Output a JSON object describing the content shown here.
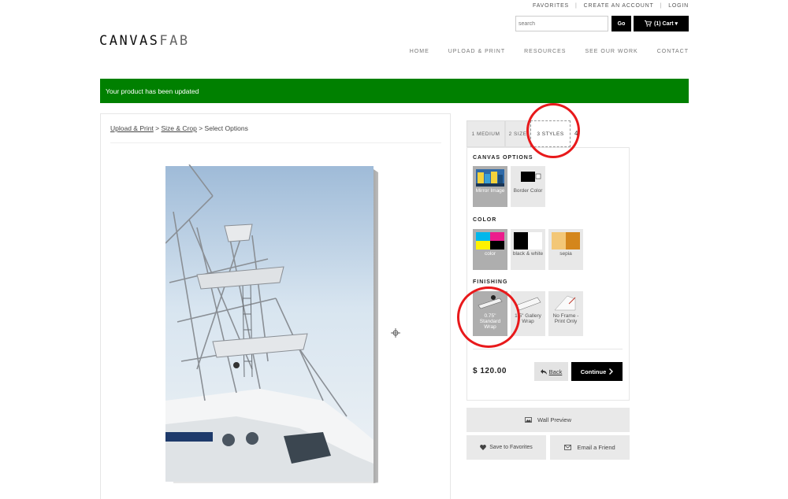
{
  "top_links": [
    "FAVORITES",
    "CREATE AN ACCOUNT",
    "LOGIN"
  ],
  "search": {
    "placeholder": "search",
    "go_label": "Go"
  },
  "cart": {
    "label": "(1)  Cart ▾"
  },
  "logo": {
    "main": "CANVAS",
    "suffix": "FAB"
  },
  "nav": [
    "HOME",
    "UPLOAD & PRINT",
    "RESOURCES",
    "SEE OUR WORK",
    "CONTACT"
  ],
  "banner": {
    "message": "Your product has been updated"
  },
  "breadcrumb": {
    "items": [
      "Upload & Print",
      "Size & Crop"
    ],
    "separator": " > ",
    "current": "Select Options"
  },
  "tabs": [
    "1 MEDIUM",
    "2 SIZE",
    "3 STYLES",
    "4"
  ],
  "sections": {
    "canvas_options": {
      "title": "CANVAS OPTIONS",
      "options": [
        {
          "label": "Mirror Image",
          "selected": true
        },
        {
          "label": "Border Color",
          "selected": false
        }
      ]
    },
    "color": {
      "title": "COLOR",
      "options": [
        {
          "label": "color",
          "selected": true
        },
        {
          "label": "black & white",
          "selected": false
        },
        {
          "label": "sepia",
          "selected": false
        }
      ]
    },
    "finishing": {
      "title": "FINISHING",
      "options": [
        {
          "label": "0.75\" Standard Wrap",
          "selected": true
        },
        {
          "label": "1.5\" Gallery Wrap",
          "selected": false
        },
        {
          "label": "No Frame - Print Only",
          "selected": false
        }
      ]
    }
  },
  "price": "$ 120.00",
  "buttons": {
    "back": "Back",
    "continue": "Continue",
    "wall_preview": "Wall Preview",
    "save_favorites": "Save to Favorites",
    "email_friend": "Email a Friend"
  },
  "colors": {
    "banner_green": "#008000",
    "highlight_red": "#e8191b",
    "button_black": "#000000",
    "selected_gray": "#aeaeae"
  }
}
